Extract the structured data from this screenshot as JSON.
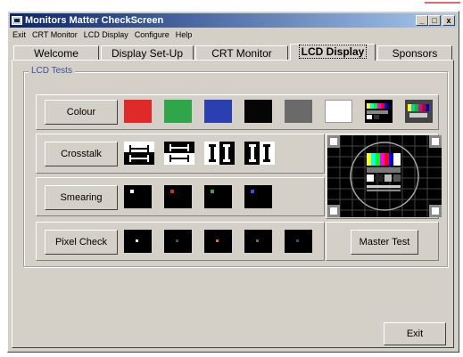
{
  "window": {
    "title": "Monitors Matter CheckScreen",
    "buttons": {
      "minimize": "_",
      "maximize": "□",
      "close": "x"
    }
  },
  "menu": [
    {
      "label": "Exit"
    },
    {
      "label": "CRT Monitor"
    },
    {
      "label": "LCD Display"
    },
    {
      "label": "Configure"
    },
    {
      "label": "Help"
    }
  ],
  "tabs": [
    {
      "label": "Welcome",
      "active": false
    },
    {
      "label": "Display Set-Up",
      "active": false
    },
    {
      "label": "CRT Monitor",
      "active": false
    },
    {
      "label": "LCD Display",
      "active": true
    },
    {
      "label": "Sponsors",
      "active": false
    }
  ],
  "group": {
    "label": "LCD Tests"
  },
  "tests": {
    "colour": {
      "label": "Colour",
      "swatches": [
        "#e02a2a",
        "#2fa64a",
        "#2a3fb0",
        "#050505",
        "#6a6a6a",
        "#ffffff",
        "test-bars",
        "test-chart"
      ]
    },
    "crosstalk": {
      "label": "Crosstalk",
      "patterns": [
        "h-white",
        "h-black",
        "i-white",
        "i-black"
      ]
    },
    "smearing": {
      "label": "Smearing",
      "dots": [
        "#ffffff",
        "#e02a2a",
        "#2fa64a",
        "#3a4fe0"
      ]
    },
    "pixel_check": {
      "label": "Pixel Check",
      "dots": [
        "#ffffff",
        "#202020",
        "#e06a2a",
        "#6a6a6a",
        "#4a3aa0"
      ]
    }
  },
  "master_test": {
    "label": "Master Test"
  },
  "exit_button": {
    "label": "Exit"
  }
}
